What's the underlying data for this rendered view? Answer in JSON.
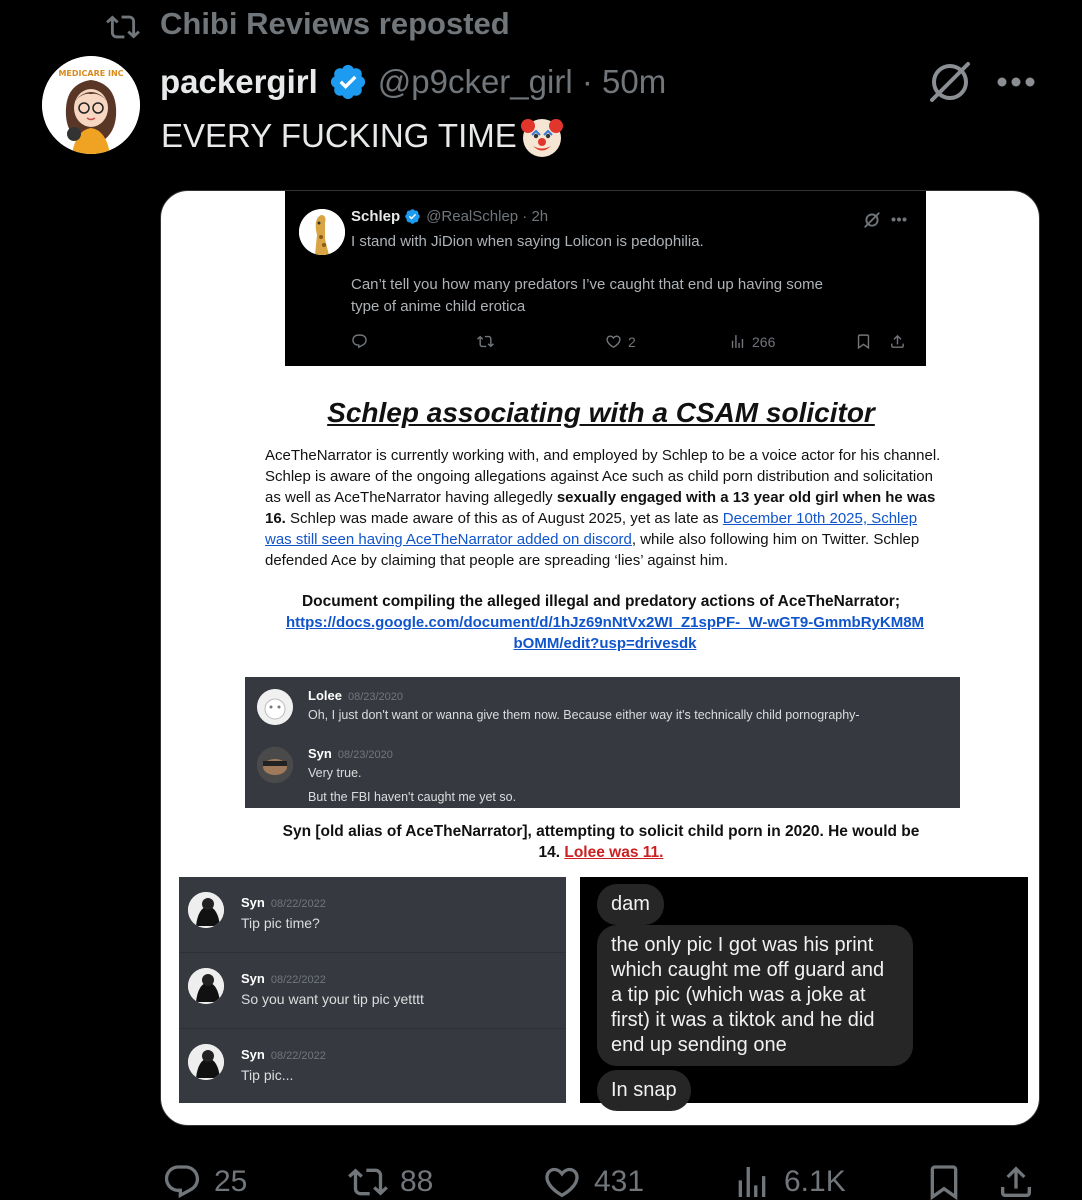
{
  "repost": {
    "text": "Chibi Reviews reposted"
  },
  "post": {
    "display_name": "packergirl",
    "handle_time": "@p9cker_girl · 50m",
    "text": "EVERY FUCKING TIME",
    "avatar_text": "MEDICARE INC",
    "emoji": "clown-face"
  },
  "embedded_tweet": {
    "name": "Schlep",
    "handle_time": "@RealSchlep · 2h",
    "line1": "I stand with JiDion when saying Lolicon is pedophilia.",
    "line2": "Can’t tell you how many predators I’ve caught that end up having some",
    "line3": "type of anime child erotica",
    "likes": "2",
    "views": "266"
  },
  "document": {
    "title": "Schlep associating with a CSAM solicitor",
    "para_1": "AceTheNarrator is currently working with, and employed by Schlep to be a voice actor for his channel. Schlep is aware of the ongoing allegations against Ace such as child porn distribution and solicitation as well as AceTheNarrator having allegedly ",
    "para_bold": "sexually engaged with a 13 year old girl when he was 16.",
    "para_2": " Schlep was made aware of this as of August 2025, yet as late as ",
    "para_link": "December 10th 2025, Schlep was still seen having AceTheNarrator added on discord",
    "para_3": ", while also following him on Twitter. Schlep defended Ace by claiming that people are spreading ‘lies’ against him.",
    "compile_line": "Document compiling the alleged illegal and predatory actions of AceTheNarrator;",
    "url_line1": "https://docs.google.com/document/d/1hJz69nNtVx2WI_Z1spPF-_W-wGT9-GmmbRyKM8M",
    "url_line2": "bOMM/edit?usp=drivesdk",
    "caption_line1": "Syn [old alias of AceTheNarrator], attempting to solicit child porn in 2020. He would be",
    "caption_line2_a": "14. ",
    "caption_line2_red": "Lolee was 11."
  },
  "discord_1": {
    "msg1_name": "Lolee",
    "msg1_date": "08/23/2020",
    "msg1_text": "Oh, I just don't want or wanna give them now. Because either way it's technically child pornography-",
    "msg2_name": "Syn",
    "msg2_date": "08/23/2020",
    "msg2_text1": "Very true.",
    "msg2_text2": "But the FBI haven't caught me yet so."
  },
  "discord_2": [
    {
      "name": "Syn",
      "date": "08/22/2022",
      "text": "Tip pic time?"
    },
    {
      "name": "Syn",
      "date": "08/22/2022",
      "text": "So you want your tip pic yetttt"
    },
    {
      "name": "Syn",
      "date": "08/22/2022",
      "text": "Tip pic..."
    }
  ],
  "chat": {
    "bubble1": "dam",
    "bubble2_l1": "the only pic I got was his print",
    "bubble2_l2": "which caught me off guard and",
    "bubble2_l3": "a tip pic (which was a joke at",
    "bubble2_l4": "first) it was a tiktok and he did",
    "bubble2_l5": "end up sending one",
    "bubble3": "In snap"
  },
  "actions": {
    "replies": "25",
    "reposts": "88",
    "likes": "431",
    "views": "6.1K"
  },
  "colors": {
    "verified": "#1d9bf0",
    "muted": "#71767b",
    "link": "#1155cc",
    "red": "#cc1f1f",
    "discord_bg": "#36393f"
  }
}
